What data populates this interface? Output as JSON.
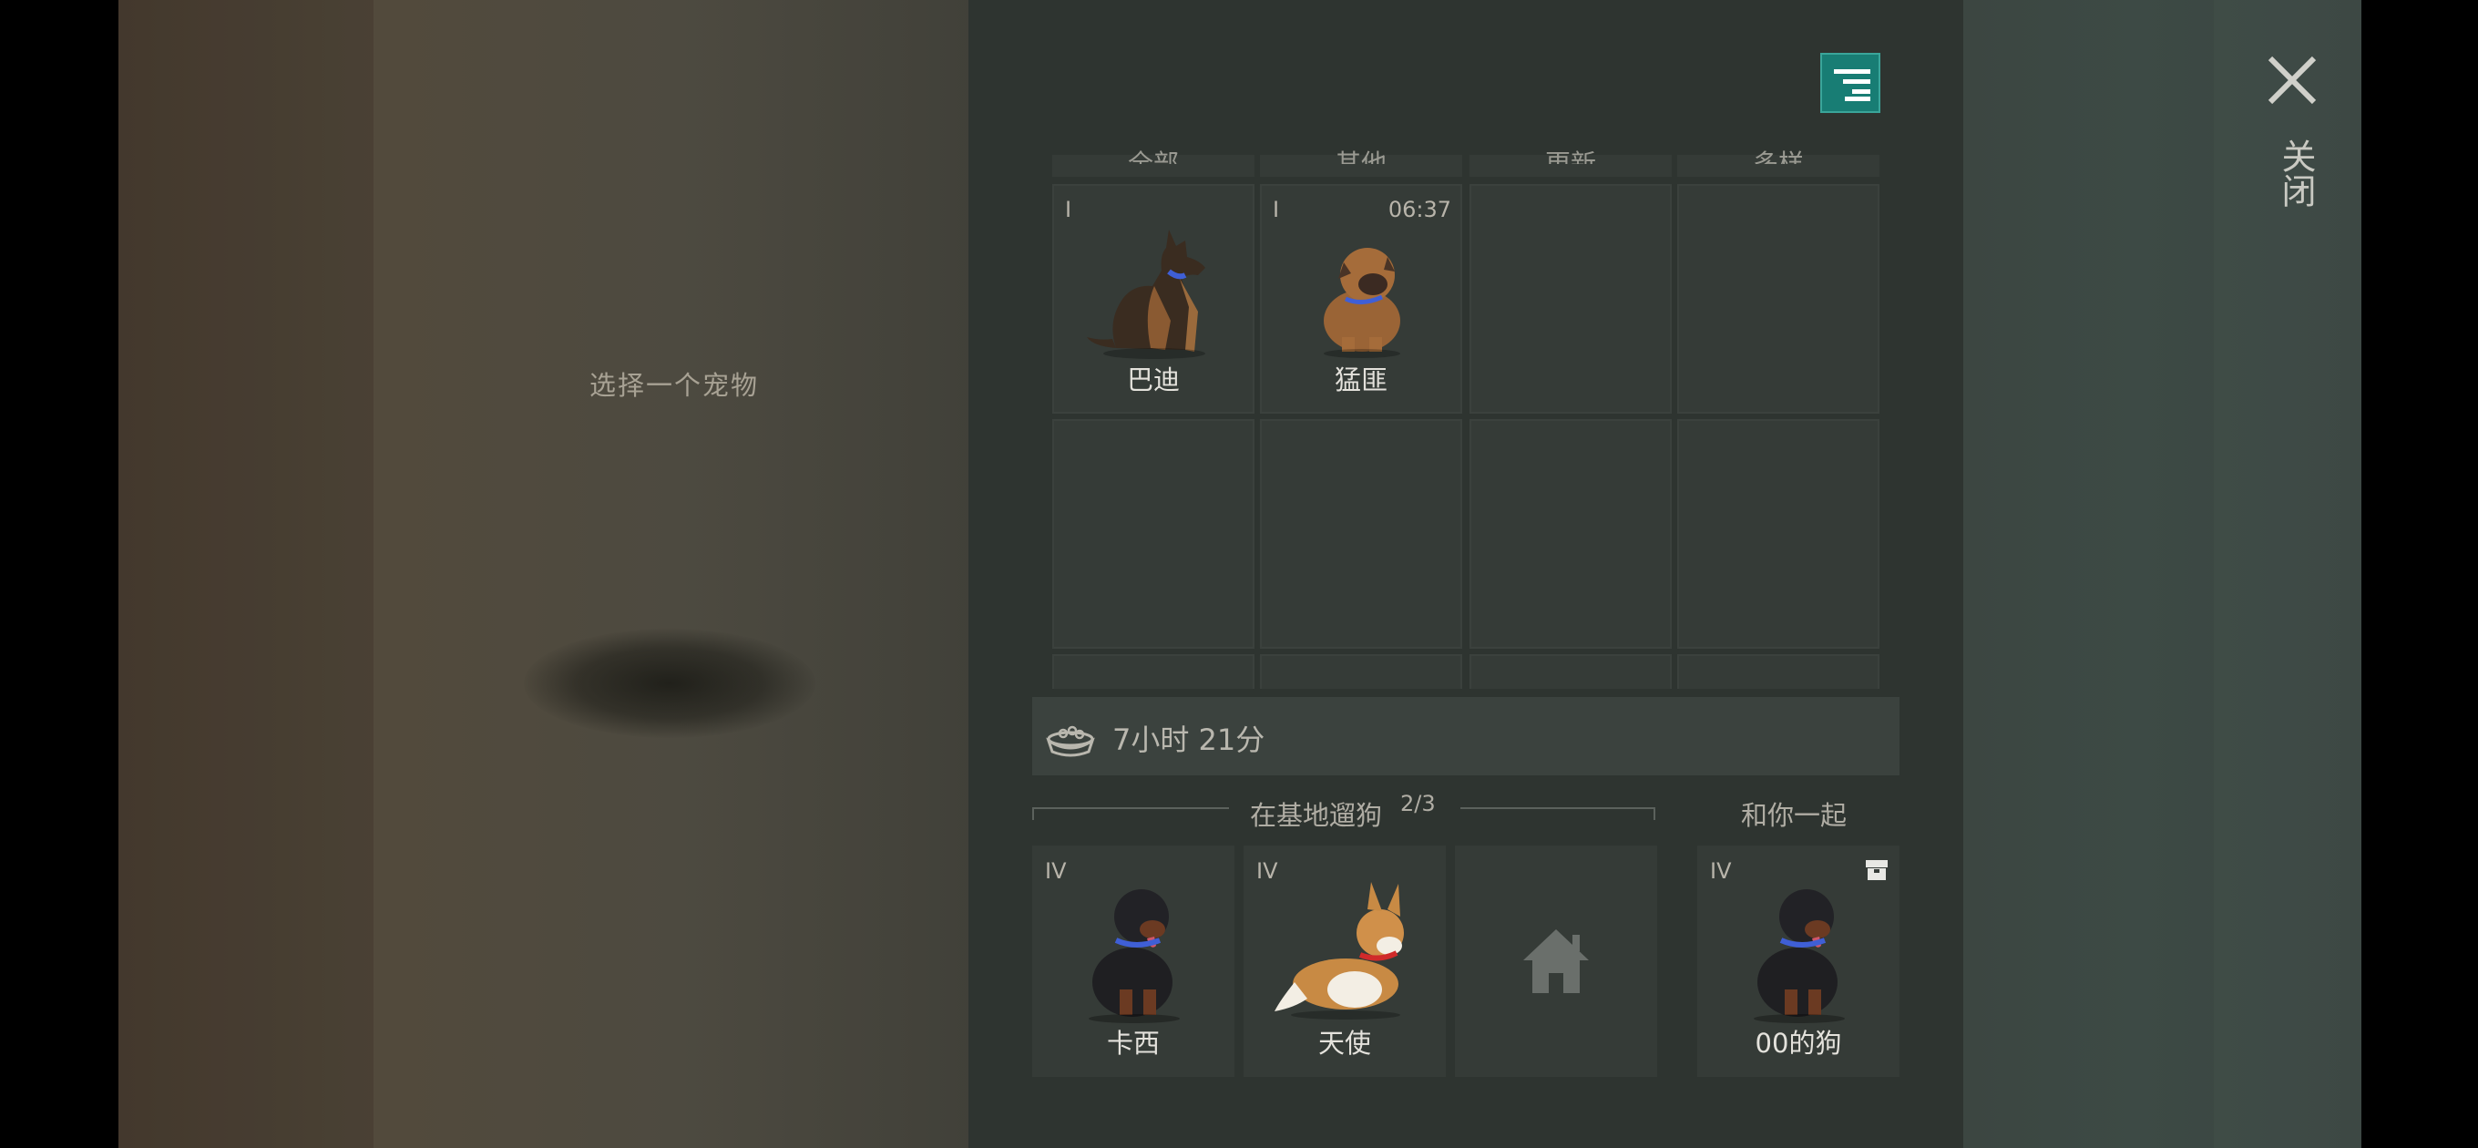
{
  "hint": "选择一个宠物",
  "close_label": "关闭",
  "tabs": [
    "全部",
    "其他",
    "更新",
    "多样"
  ],
  "pets_grid": [
    {
      "tier": "I",
      "name": "巴迪",
      "timer": "",
      "breed": "german-shepherd"
    },
    {
      "tier": "I",
      "name": "猛匪",
      "timer": "06:37",
      "breed": "pug-mix"
    }
  ],
  "food": {
    "remaining": "7小时 21分"
  },
  "walk": {
    "title": "在基地遛狗",
    "count": "2/3"
  },
  "with_you": {
    "title": "和你一起"
  },
  "walk_slots": [
    {
      "tier": "IV",
      "name": "卡西",
      "breed": "rottweiler"
    },
    {
      "tier": "IV",
      "name": "天使",
      "breed": "corgi"
    }
  ],
  "companion": {
    "tier": "IV",
    "name": "00的狗",
    "breed": "rottweiler"
  },
  "icons": {
    "menu": "sort-menu-icon",
    "close": "close-icon",
    "food": "food-bowl-icon",
    "home": "home-icon",
    "chest": "chest-icon"
  },
  "colors": {
    "accent": "#187d74",
    "panel": "#2e3430",
    "cell": "#353b37"
  }
}
